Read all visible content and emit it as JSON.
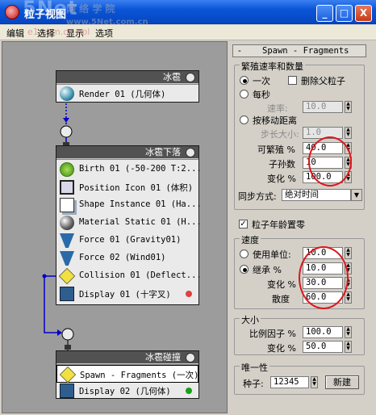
{
  "window": {
    "title": "粒子视图",
    "watermark": "5Net",
    "watermark_site": "网 络 学 院",
    "watermark_cn": "www.5Net.com.cn",
    "min_label": "_",
    "max_label": "□",
    "close_label": "X"
  },
  "menu": {
    "items": [
      "编辑",
      "选择",
      "显示",
      "选项"
    ],
    "watermark": "e1 com.cn ool"
  },
  "events": {
    "hail": {
      "title": "冰雹",
      "ops": [
        "Render 01 (几何体)"
      ]
    },
    "hail_fall": {
      "title": "冰雹下落",
      "ops": [
        "Birth 01 (-50-200 T:2...",
        "Position Icon 01 (体积)",
        "Shape Instance 01 (Ha...",
        "Material Static 01 (H...",
        "Force 01 (Gravity01)",
        "Force 02 (Wind01)",
        "Collision 01 (Deflect...",
        "Display 01 (十字叉)"
      ]
    },
    "hail_collide": {
      "title": "冰雹碰撞",
      "ops": [
        "Spawn - Fragments (一次)",
        "Display 02 (几何体)"
      ]
    },
    "colors": {
      "display01": "#e04040",
      "display02": "#18a018",
      "header": "#525252"
    }
  },
  "panel": {
    "rollout_title": "Spawn - Fragments",
    "rollout_sign": "-",
    "rate_group": {
      "title": "繁殖速率和数量",
      "once": "一次",
      "delete_parent": "删除父粒子",
      "per_second": "每秒",
      "rate_label": "速率:",
      "rate_value": "10.0",
      "by_distance": "按移动距离",
      "step_label": "步长大小:",
      "step_value": "1.0",
      "spawnable_label": "可繁殖 %",
      "spawnable_value": "40.0",
      "offspring_label": "子孙数",
      "offspring_value": "10",
      "variation_label": "变化 %",
      "variation_value": "100.0",
      "sync_label": "同步方式:",
      "sync_value": "绝对时间"
    },
    "restart_age": "粒子年龄置零",
    "speed_group": {
      "title": "速度",
      "use_units": "使用单位:",
      "use_units_value": "10.0",
      "inherit": "继承 %",
      "inherit_value": "10.0",
      "variation_label": "变化 %",
      "variation_value": "30.0",
      "divergence_label": "散度",
      "divergence_value": "60.0"
    },
    "size_group": {
      "title": "大小",
      "scale_label": "比例因子 %",
      "scale_value": "100.0",
      "variation_label": "变化 %",
      "variation_value": "50.0"
    },
    "uniqueness_group": {
      "title": "唯一性",
      "seed_label": "种子:",
      "seed_value": "12345",
      "new_button": "新建"
    }
  }
}
